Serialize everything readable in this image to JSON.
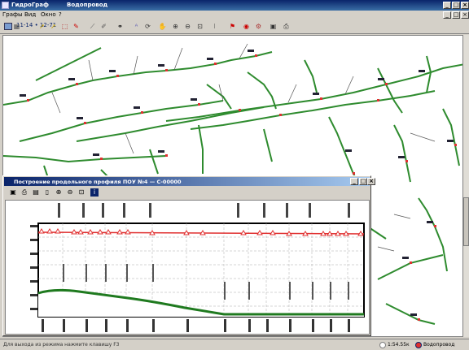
{
  "app": {
    "title": "ГидроГраф",
    "document": "Водопровод"
  },
  "window_buttons": {
    "minimize": "_",
    "maximize": "□",
    "close": "×"
  },
  "menu": [
    "Графы",
    "Вид",
    "Окно",
    "?"
  ],
  "toolbar": {
    "crumb": "11-14 • 12-71",
    "icons": [
      "grid-icon",
      "select-arrow-icon",
      "select-yellow-icon",
      "select-box-icon",
      "select-node-icon",
      "draw-line-icon",
      "edit-icon",
      "binoculars-icon",
      "text-icon",
      "rotate-icon",
      "pan-hand-icon",
      "zoom-in-icon",
      "zoom-out-icon",
      "zoom-window-icon",
      "layers-icon",
      "traffic-light-icon",
      "stop-icon",
      "node-tool-icon",
      "save-icon",
      "print-icon"
    ]
  },
  "profile_window": {
    "title": "Построение продольного профиля ПОУ №4 — С-00000",
    "tool_icons": [
      "save-icon",
      "print-icon",
      "preview-icon",
      "page-icon",
      "zoom-in-icon",
      "zoom-out-icon",
      "zoom-window-icon",
      "info-icon"
    ]
  },
  "status": {
    "message": "Для выхода из режима нажмите клавишу F3",
    "coords": "1:54.55к",
    "layer": "Водопровод"
  },
  "colors": {
    "pipe": "#2e8b2e",
    "pressure": "#e03030",
    "ground": "#1f7a1f",
    "title": "#0a246a"
  }
}
